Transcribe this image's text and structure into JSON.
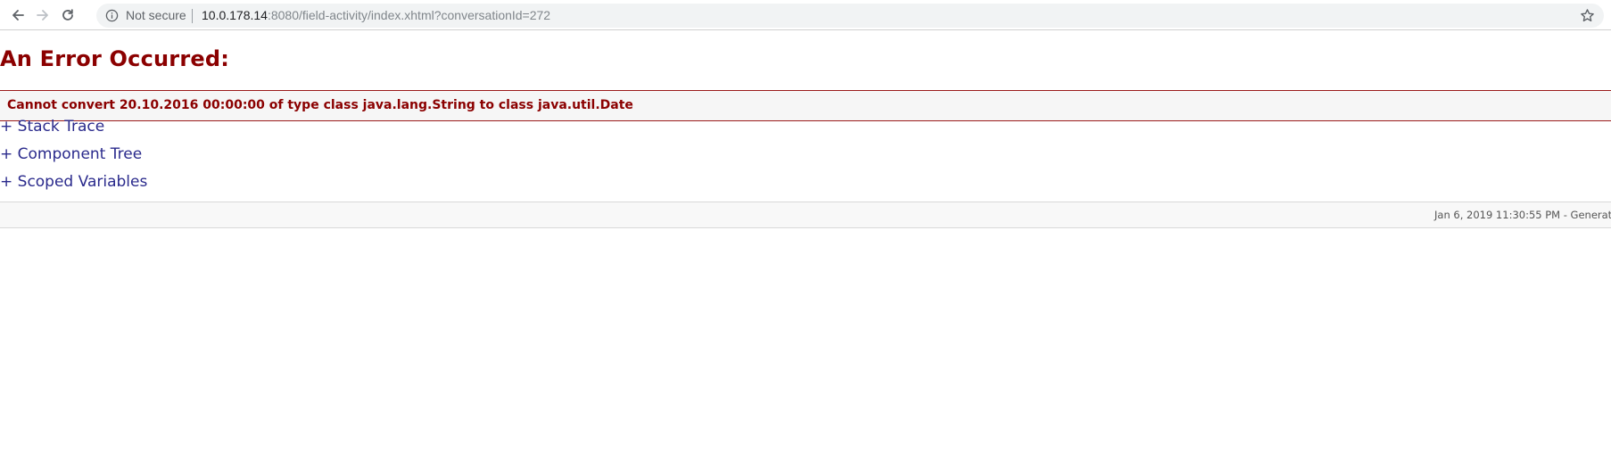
{
  "browser": {
    "security_label": "Not secure",
    "url_host": "10.0.178.14",
    "url_rest": ":8080/field-activity/index.xhtml?conversationId=272",
    "icons": [
      "back-arrow-icon",
      "forward-arrow-icon",
      "reload-icon",
      "info-icon",
      "star-icon"
    ]
  },
  "page": {
    "title": "An Error Occurred:",
    "error_message": "Cannot convert 20.10.2016 00:00:00 of type class java.lang.String to class java.util.Date",
    "sections": {
      "stack_trace": "+ Stack Trace",
      "component_tree": "+ Component Tree",
      "scoped_variables": "+ Scoped Variables"
    },
    "footer": "Jan 6, 2019 11:30:55 PM - Generat"
  },
  "colors": {
    "error_red": "#8b0000",
    "link_blue": "#2a2a8c"
  }
}
